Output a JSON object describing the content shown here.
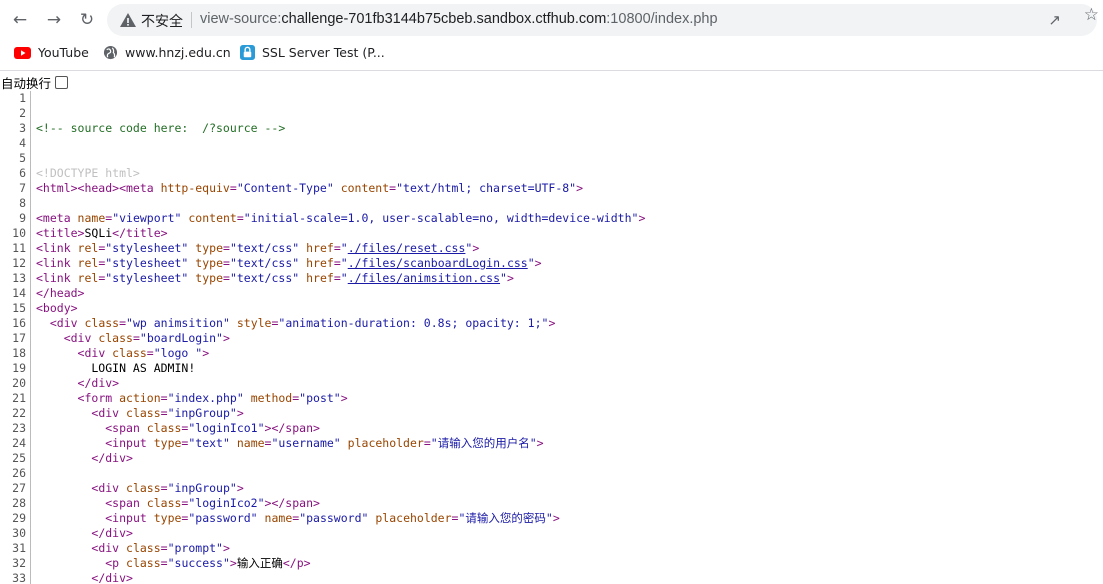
{
  "browser": {
    "security_label": "不安全",
    "url_scheme": "view-source:",
    "url_host": "challenge-701fb3144b75cbeb.sandbox.ctfhub.com",
    "url_rest": ":10800/index.php"
  },
  "bookmarks": [
    {
      "label": "YouTube",
      "icon": "youtube-icon"
    },
    {
      "label": "www.hnzj.edu.cn",
      "icon": "globe-icon"
    },
    {
      "label": "SSL Server Test (P...",
      "icon": "ssl-icon"
    }
  ],
  "wrap_toggle": {
    "label": "自动换行",
    "checked": false
  },
  "source_lines": [
    {
      "n": "1",
      "parts": []
    },
    {
      "n": "2",
      "parts": []
    },
    {
      "n": "3",
      "parts": [
        {
          "c": "comment",
          "t": "<!-- source code here:  /?source -->"
        }
      ]
    },
    {
      "n": "4",
      "parts": []
    },
    {
      "n": "5",
      "parts": []
    },
    {
      "n": "6",
      "parts": [
        {
          "c": "doctype",
          "t": "<!DOCTYPE html>"
        }
      ]
    },
    {
      "n": "7",
      "parts": [
        {
          "c": "tag",
          "t": "<html><head><meta "
        },
        {
          "c": "attr",
          "t": "http-equiv"
        },
        {
          "c": "tag",
          "t": "="
        },
        {
          "c": "val",
          "t": "\"Content-Type\""
        },
        {
          "c": "tag",
          "t": " "
        },
        {
          "c": "attr",
          "t": "content"
        },
        {
          "c": "tag",
          "t": "="
        },
        {
          "c": "val",
          "t": "\"text/html; charset=UTF-8\""
        },
        {
          "c": "tag",
          "t": ">"
        }
      ]
    },
    {
      "n": "8",
      "parts": []
    },
    {
      "n": "9",
      "parts": [
        {
          "c": "tag",
          "t": "<meta "
        },
        {
          "c": "attr",
          "t": "name"
        },
        {
          "c": "tag",
          "t": "="
        },
        {
          "c": "val",
          "t": "\"viewport\""
        },
        {
          "c": "tag",
          "t": " "
        },
        {
          "c": "attr",
          "t": "content"
        },
        {
          "c": "tag",
          "t": "="
        },
        {
          "c": "val",
          "t": "\"initial-scale=1.0, user-scalable=no, width=device-width\""
        },
        {
          "c": "tag",
          "t": ">"
        }
      ]
    },
    {
      "n": "10",
      "parts": [
        {
          "c": "tag",
          "t": "<title>"
        },
        {
          "c": "text",
          "t": "SQLi"
        },
        {
          "c": "tag",
          "t": "</title>"
        }
      ]
    },
    {
      "n": "11",
      "parts": [
        {
          "c": "tag",
          "t": "<link "
        },
        {
          "c": "attr",
          "t": "rel"
        },
        {
          "c": "tag",
          "t": "="
        },
        {
          "c": "val",
          "t": "\"stylesheet\""
        },
        {
          "c": "tag",
          "t": " "
        },
        {
          "c": "attr",
          "t": "type"
        },
        {
          "c": "tag",
          "t": "="
        },
        {
          "c": "val",
          "t": "\"text/css\""
        },
        {
          "c": "tag",
          "t": " "
        },
        {
          "c": "attr",
          "t": "href"
        },
        {
          "c": "tag",
          "t": "="
        },
        {
          "c": "val",
          "t": "\""
        },
        {
          "c": "link",
          "t": "./files/reset.css"
        },
        {
          "c": "val",
          "t": "\""
        },
        {
          "c": "tag",
          "t": ">"
        }
      ]
    },
    {
      "n": "12",
      "parts": [
        {
          "c": "tag",
          "t": "<link "
        },
        {
          "c": "attr",
          "t": "rel"
        },
        {
          "c": "tag",
          "t": "="
        },
        {
          "c": "val",
          "t": "\"stylesheet\""
        },
        {
          "c": "tag",
          "t": " "
        },
        {
          "c": "attr",
          "t": "type"
        },
        {
          "c": "tag",
          "t": "="
        },
        {
          "c": "val",
          "t": "\"text/css\""
        },
        {
          "c": "tag",
          "t": " "
        },
        {
          "c": "attr",
          "t": "href"
        },
        {
          "c": "tag",
          "t": "="
        },
        {
          "c": "val",
          "t": "\""
        },
        {
          "c": "link",
          "t": "./files/scanboardLogin.css"
        },
        {
          "c": "val",
          "t": "\""
        },
        {
          "c": "tag",
          "t": ">"
        }
      ]
    },
    {
      "n": "13",
      "parts": [
        {
          "c": "tag",
          "t": "<link "
        },
        {
          "c": "attr",
          "t": "rel"
        },
        {
          "c": "tag",
          "t": "="
        },
        {
          "c": "val",
          "t": "\"stylesheet\""
        },
        {
          "c": "tag",
          "t": " "
        },
        {
          "c": "attr",
          "t": "type"
        },
        {
          "c": "tag",
          "t": "="
        },
        {
          "c": "val",
          "t": "\"text/css\""
        },
        {
          "c": "tag",
          "t": " "
        },
        {
          "c": "attr",
          "t": "href"
        },
        {
          "c": "tag",
          "t": "="
        },
        {
          "c": "val",
          "t": "\""
        },
        {
          "c": "link",
          "t": "./files/animsition.css"
        },
        {
          "c": "val",
          "t": "\""
        },
        {
          "c": "tag",
          "t": ">"
        }
      ]
    },
    {
      "n": "14",
      "parts": [
        {
          "c": "tag",
          "t": "</head>"
        }
      ]
    },
    {
      "n": "15",
      "parts": [
        {
          "c": "tag",
          "t": "<body>"
        }
      ]
    },
    {
      "n": "16",
      "parts": [
        {
          "c": "text",
          "t": "  "
        },
        {
          "c": "tag",
          "t": "<div "
        },
        {
          "c": "attr",
          "t": "class"
        },
        {
          "c": "tag",
          "t": "="
        },
        {
          "c": "val",
          "t": "\"wp animsition\""
        },
        {
          "c": "tag",
          "t": " "
        },
        {
          "c": "attr",
          "t": "style"
        },
        {
          "c": "tag",
          "t": "="
        },
        {
          "c": "val",
          "t": "\"animation-duration: 0.8s; opacity: 1;\""
        },
        {
          "c": "tag",
          "t": ">"
        }
      ]
    },
    {
      "n": "17",
      "parts": [
        {
          "c": "text",
          "t": "    "
        },
        {
          "c": "tag",
          "t": "<div "
        },
        {
          "c": "attr",
          "t": "class"
        },
        {
          "c": "tag",
          "t": "="
        },
        {
          "c": "val",
          "t": "\"boardLogin\""
        },
        {
          "c": "tag",
          "t": ">"
        }
      ]
    },
    {
      "n": "18",
      "parts": [
        {
          "c": "text",
          "t": "      "
        },
        {
          "c": "tag",
          "t": "<div "
        },
        {
          "c": "attr",
          "t": "class"
        },
        {
          "c": "tag",
          "t": "="
        },
        {
          "c": "val",
          "t": "\"logo \""
        },
        {
          "c": "tag",
          "t": ">"
        }
      ]
    },
    {
      "n": "19",
      "parts": [
        {
          "c": "text",
          "t": "        LOGIN AS ADMIN!"
        }
      ]
    },
    {
      "n": "20",
      "parts": [
        {
          "c": "text",
          "t": "      "
        },
        {
          "c": "tag",
          "t": "</div>"
        }
      ]
    },
    {
      "n": "21",
      "parts": [
        {
          "c": "text",
          "t": "      "
        },
        {
          "c": "tag",
          "t": "<form "
        },
        {
          "c": "attr",
          "t": "action"
        },
        {
          "c": "tag",
          "t": "="
        },
        {
          "c": "val",
          "t": "\"index.php\""
        },
        {
          "c": "tag",
          "t": " "
        },
        {
          "c": "attr",
          "t": "method"
        },
        {
          "c": "tag",
          "t": "="
        },
        {
          "c": "val",
          "t": "\"post\""
        },
        {
          "c": "tag",
          "t": ">"
        }
      ]
    },
    {
      "n": "22",
      "parts": [
        {
          "c": "text",
          "t": "        "
        },
        {
          "c": "tag",
          "t": "<div "
        },
        {
          "c": "attr",
          "t": "class"
        },
        {
          "c": "tag",
          "t": "="
        },
        {
          "c": "val",
          "t": "\"inpGroup\""
        },
        {
          "c": "tag",
          "t": ">"
        }
      ]
    },
    {
      "n": "23",
      "parts": [
        {
          "c": "text",
          "t": "          "
        },
        {
          "c": "tag",
          "t": "<span "
        },
        {
          "c": "attr",
          "t": "class"
        },
        {
          "c": "tag",
          "t": "="
        },
        {
          "c": "val",
          "t": "\"loginIco1\""
        },
        {
          "c": "tag",
          "t": "></span>"
        }
      ]
    },
    {
      "n": "24",
      "parts": [
        {
          "c": "text",
          "t": "          "
        },
        {
          "c": "tag",
          "t": "<input "
        },
        {
          "c": "attr",
          "t": "type"
        },
        {
          "c": "tag",
          "t": "="
        },
        {
          "c": "val",
          "t": "\"text\""
        },
        {
          "c": "tag",
          "t": " "
        },
        {
          "c": "attr",
          "t": "name"
        },
        {
          "c": "tag",
          "t": "="
        },
        {
          "c": "val",
          "t": "\"username\""
        },
        {
          "c": "tag",
          "t": " "
        },
        {
          "c": "attr",
          "t": "placeholder"
        },
        {
          "c": "tag",
          "t": "="
        },
        {
          "c": "val",
          "t": "\"请输入您的用户名\""
        },
        {
          "c": "tag",
          "t": ">"
        }
      ]
    },
    {
      "n": "25",
      "parts": [
        {
          "c": "text",
          "t": "        "
        },
        {
          "c": "tag",
          "t": "</div>"
        }
      ]
    },
    {
      "n": "26",
      "parts": []
    },
    {
      "n": "27",
      "parts": [
        {
          "c": "text",
          "t": "        "
        },
        {
          "c": "tag",
          "t": "<div "
        },
        {
          "c": "attr",
          "t": "class"
        },
        {
          "c": "tag",
          "t": "="
        },
        {
          "c": "val",
          "t": "\"inpGroup\""
        },
        {
          "c": "tag",
          "t": ">"
        }
      ]
    },
    {
      "n": "28",
      "parts": [
        {
          "c": "text",
          "t": "          "
        },
        {
          "c": "tag",
          "t": "<span "
        },
        {
          "c": "attr",
          "t": "class"
        },
        {
          "c": "tag",
          "t": "="
        },
        {
          "c": "val",
          "t": "\"loginIco2\""
        },
        {
          "c": "tag",
          "t": "></span>"
        }
      ]
    },
    {
      "n": "29",
      "parts": [
        {
          "c": "text",
          "t": "          "
        },
        {
          "c": "tag",
          "t": "<input "
        },
        {
          "c": "attr",
          "t": "type"
        },
        {
          "c": "tag",
          "t": "="
        },
        {
          "c": "val",
          "t": "\"password\""
        },
        {
          "c": "tag",
          "t": " "
        },
        {
          "c": "attr",
          "t": "name"
        },
        {
          "c": "tag",
          "t": "="
        },
        {
          "c": "val",
          "t": "\"password\""
        },
        {
          "c": "tag",
          "t": " "
        },
        {
          "c": "attr",
          "t": "placeholder"
        },
        {
          "c": "tag",
          "t": "="
        },
        {
          "c": "val",
          "t": "\"请输入您的密码\""
        },
        {
          "c": "tag",
          "t": ">"
        }
      ]
    },
    {
      "n": "30",
      "parts": [
        {
          "c": "text",
          "t": "        "
        },
        {
          "c": "tag",
          "t": "</div>"
        }
      ]
    },
    {
      "n": "31",
      "parts": [
        {
          "c": "text",
          "t": "        "
        },
        {
          "c": "tag",
          "t": "<div "
        },
        {
          "c": "attr",
          "t": "class"
        },
        {
          "c": "tag",
          "t": "="
        },
        {
          "c": "val",
          "t": "\"prompt\""
        },
        {
          "c": "tag",
          "t": ">"
        }
      ]
    },
    {
      "n": "32",
      "parts": [
        {
          "c": "text",
          "t": "          "
        },
        {
          "c": "tag",
          "t": "<p "
        },
        {
          "c": "attr",
          "t": "class"
        },
        {
          "c": "tag",
          "t": "="
        },
        {
          "c": "val",
          "t": "\"success\""
        },
        {
          "c": "tag",
          "t": ">"
        },
        {
          "c": "text",
          "t": "输入正确"
        },
        {
          "c": "tag",
          "t": "</p>"
        }
      ]
    },
    {
      "n": "33",
      "parts": [
        {
          "c": "text",
          "t": "        "
        },
        {
          "c": "tag",
          "t": "</div>"
        }
      ]
    }
  ]
}
